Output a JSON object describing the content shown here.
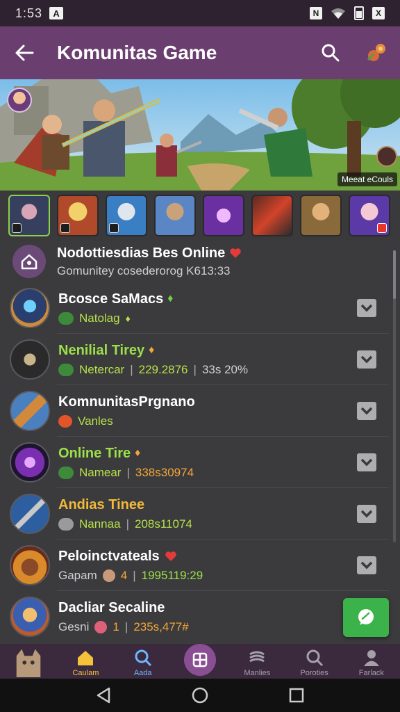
{
  "status_bar": {
    "time": "1:53",
    "left_badge": "A",
    "right_badges": [
      "N",
      "X"
    ]
  },
  "app_bar": {
    "title": "Komunitas Game"
  },
  "banner": {
    "badge_text": "Meeat eCouls"
  },
  "header": {
    "title": "Nodottiesdias Bes Online",
    "subtitle": "Gomunitey cosederorog K613:33"
  },
  "rows": [
    {
      "name": "Bcosce SaMacs",
      "name_color": "#ffffff",
      "meta_label": "Natolag",
      "meta_color": "#9be04a",
      "stat1": "",
      "stat2": ""
    },
    {
      "name": "Nenilial Tirey",
      "name_color": "#9be04a",
      "meta_label": "Netercar",
      "meta_color": "#9be04a",
      "stat1": "229.2876",
      "stat2": "33s 20%"
    },
    {
      "name": "KomnunitasPrgnano",
      "name_color": "#ffffff",
      "meta_label": "Vanles",
      "meta_color": "#9be04a",
      "stat1": "",
      "stat2": ""
    },
    {
      "name": "Online Tire",
      "name_color": "#9be04a",
      "meta_label": "Namear",
      "meta_color": "#9be04a",
      "stat1": "338s30974",
      "stat2": ""
    },
    {
      "name": "Andias Tinee",
      "name_color": "#f3b93a",
      "meta_label": "Nannaa",
      "meta_color": "#9be04a",
      "stat1": "208s11074",
      "stat2": ""
    },
    {
      "name": "Peloinctvateals",
      "name_color": "#ffffff",
      "meta_label": "Gapam",
      "meta_color": "#cfcfd3",
      "badge": "4",
      "stat1": "1995119:29",
      "stat2": ""
    },
    {
      "name": "Dacliar Secaline",
      "name_color": "#ffffff",
      "meta_label": "Gesni",
      "meta_color": "#cfcfd3",
      "badge": "1",
      "stat1": "235s,477#",
      "stat2": ""
    }
  ],
  "bottom_nav": [
    {
      "label": "",
      "icon": "cat-avatar"
    },
    {
      "label": "Caulam",
      "icon": "home-icon"
    },
    {
      "label": "Aada",
      "icon": "search-icon"
    },
    {
      "label": "",
      "icon": "grid-icon"
    },
    {
      "label": "Manlies",
      "icon": "layers-icon"
    },
    {
      "label": "Poroties",
      "icon": "search-icon"
    },
    {
      "label": "Farlack",
      "icon": "person-icon"
    }
  ],
  "colors": {
    "app_bar": "#6a3f6f",
    "accent_green": "#3cb34a",
    "list_bg": "#3b3b3d"
  }
}
